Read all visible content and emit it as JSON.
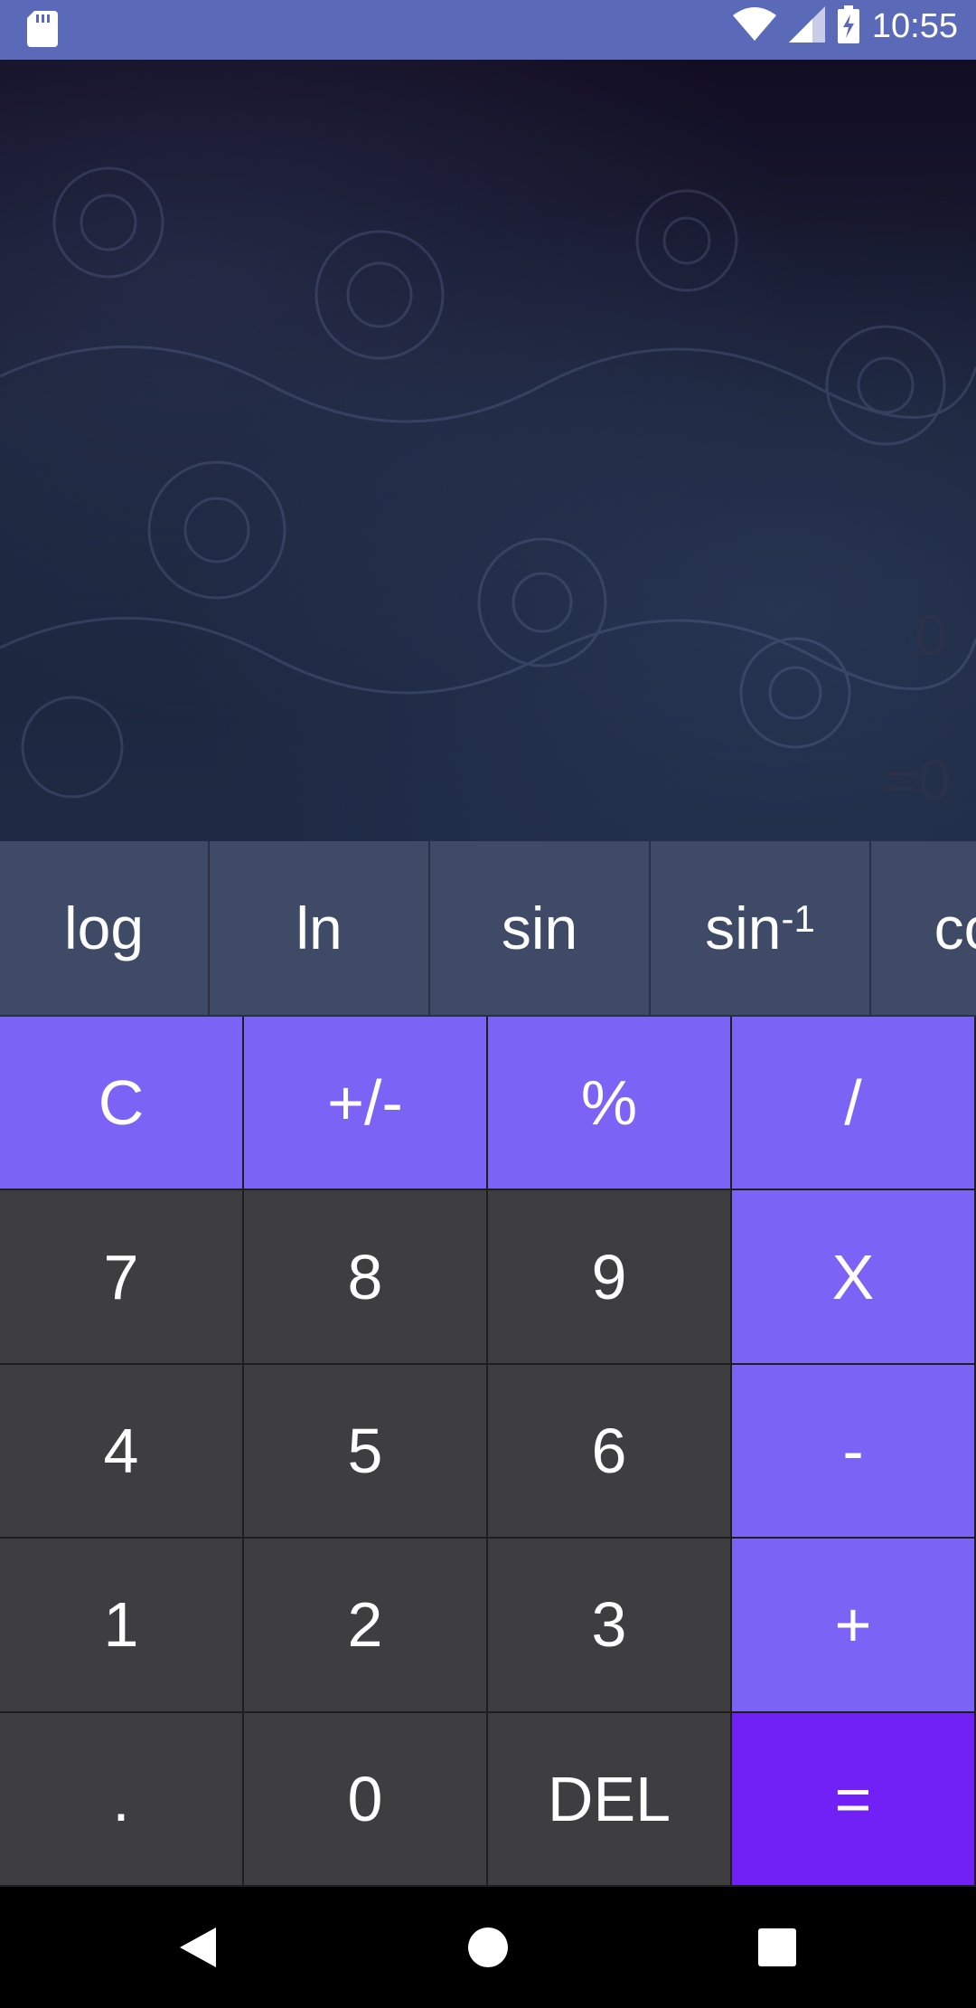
{
  "status_bar": {
    "time": "10:55",
    "icons": [
      "sd-card-icon",
      "wifi-icon",
      "signal-icon",
      "battery-charging-icon"
    ]
  },
  "display": {
    "expression": "0",
    "result": "=0"
  },
  "scientific": {
    "buttons": [
      {
        "label": "log"
      },
      {
        "label": "ln"
      },
      {
        "label": "sin"
      },
      {
        "label": "sin",
        "sup": "-1"
      },
      {
        "label": "cos"
      }
    ]
  },
  "keypad": {
    "rows": [
      [
        "C",
        "+/-",
        "%",
        "/"
      ],
      [
        "7",
        "8",
        "9",
        "X"
      ],
      [
        "4",
        "5",
        "6",
        "-"
      ],
      [
        "1",
        "2",
        "3",
        "+"
      ],
      [
        ".",
        "0",
        "DEL",
        "="
      ]
    ]
  },
  "colors": {
    "status_bar": "#5b6ab8",
    "sci_row": "#3f4a67",
    "num_key": "#3e3d3f",
    "op_key": "#7b63f6",
    "equals_key": "#7120f5"
  },
  "nav": {
    "icons": [
      "back-icon",
      "home-icon",
      "recents-icon"
    ]
  }
}
